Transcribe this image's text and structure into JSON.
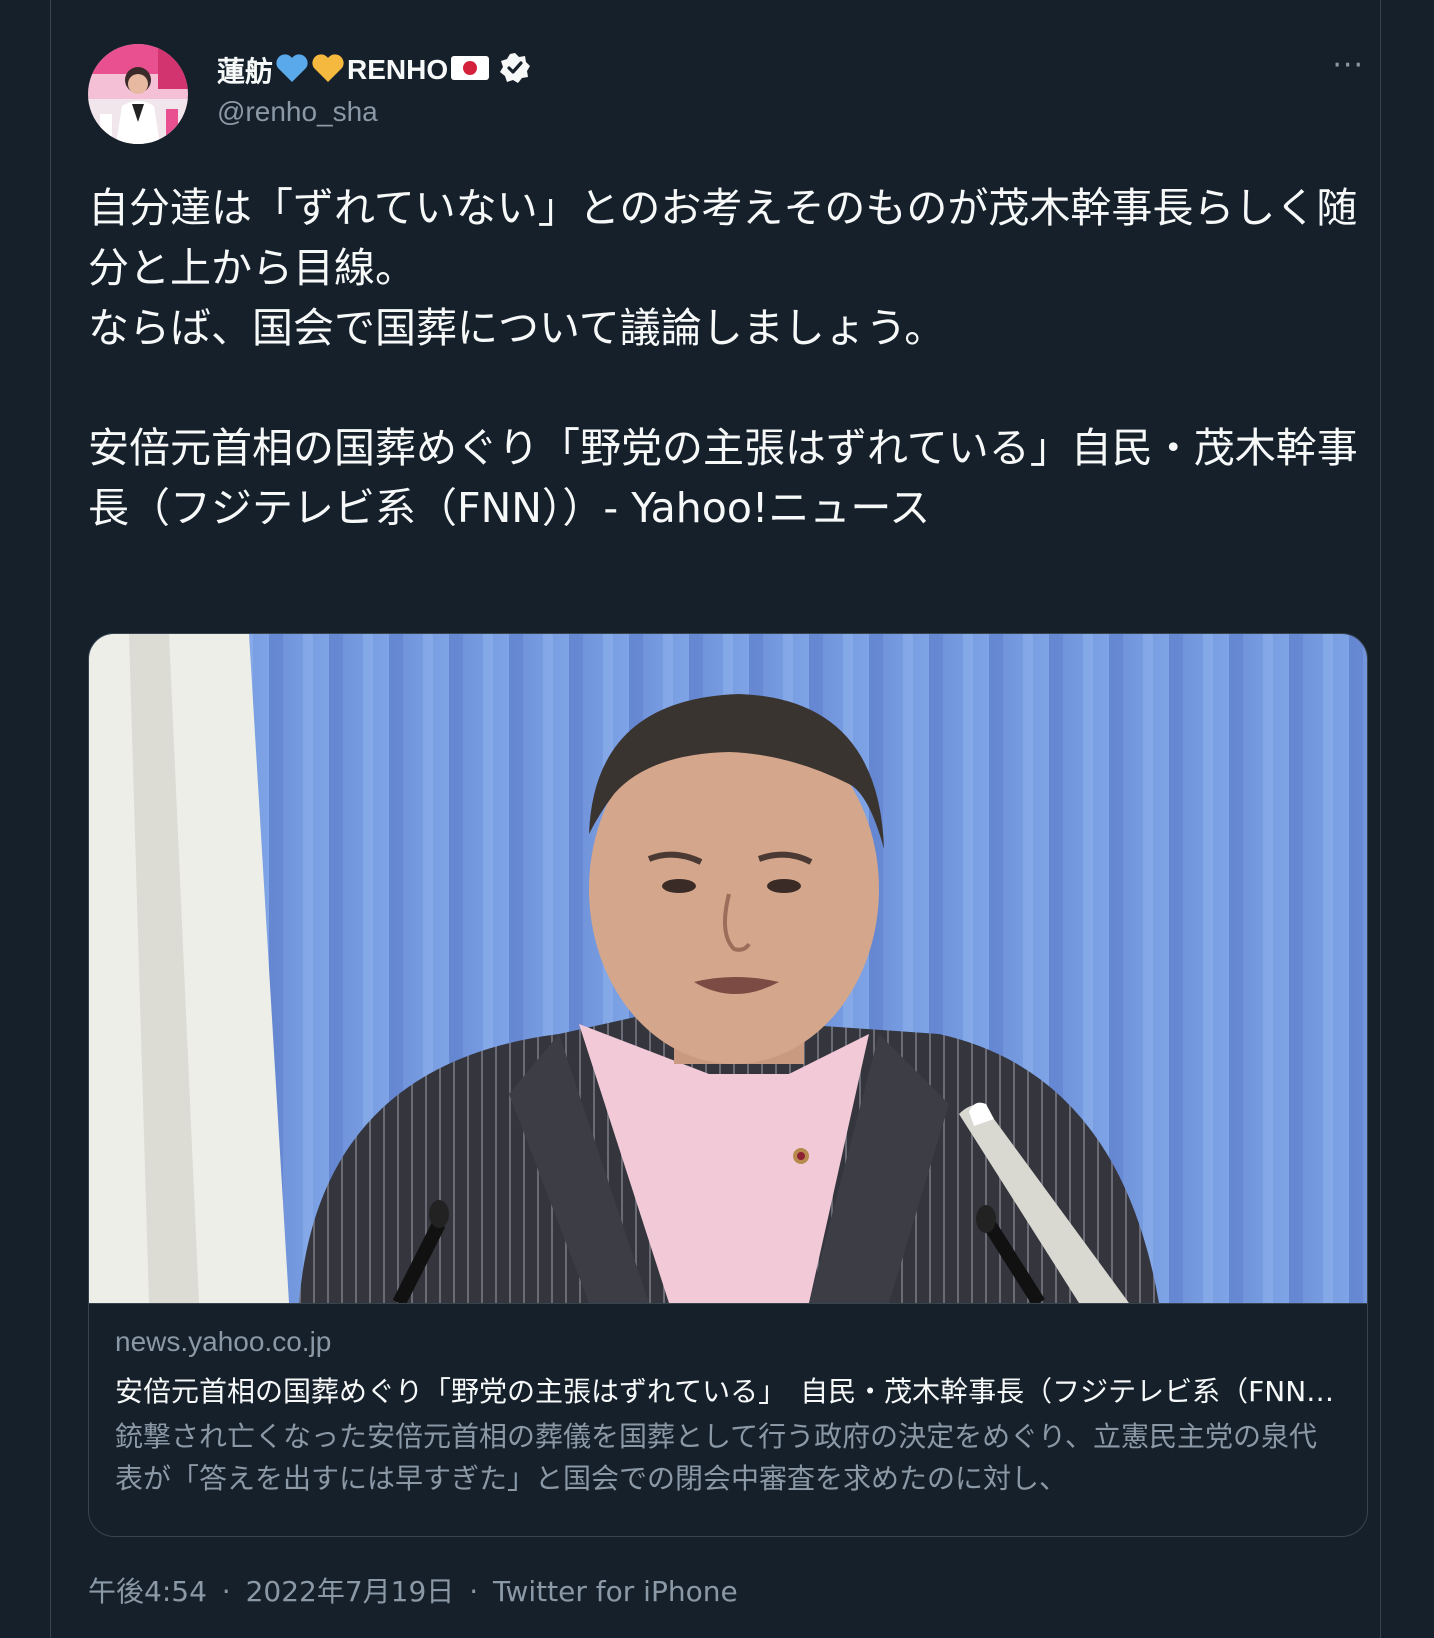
{
  "user": {
    "display_name": "蓮舫💙💛RENHO🇯🇵",
    "name_part_1": "蓮舫",
    "name_part_2": "RENHO",
    "handle": "@renho_sha",
    "verified": true,
    "emojis": [
      "blue-heart",
      "yellow-heart",
      "japan-flag"
    ]
  },
  "more_label": "···",
  "tweet": {
    "text": "自分達は「ずれていない」とのお考えそのものが茂木幹事長らしく随分と上から目線。\nならば、国会で国葬について議論しましょう。\n\n安倍元首相の国葬めぐり「野党の主張はずれている」自民・茂木幹事長（フジテレビ系（FNN））- Yahoo!ニュース"
  },
  "card": {
    "domain": "news.yahoo.co.jp",
    "title": "安倍元首相の国葬めぐり「野党の主張はずれている」　自民・茂木幹事長（フジテレビ系（FNN））- Yahoo!ニュース",
    "description": "銃撃され亡くなった安倍元首相の葬儀を国葬として行う政府の決定をめぐり、立憲民主党の泉代表が「答えを出すには早すぎた」と国会での閉会中審査を求めたのに対し、"
  },
  "meta": {
    "time": "午後4:54",
    "date": "2022年7月19日",
    "client": "Twitter for iPhone",
    "separator": "·"
  },
  "colors": {
    "background": "#15202b",
    "text": "#f7f9f9",
    "secondary": "#8b98a5",
    "border": "#38444d",
    "verified": "#ffffff"
  }
}
